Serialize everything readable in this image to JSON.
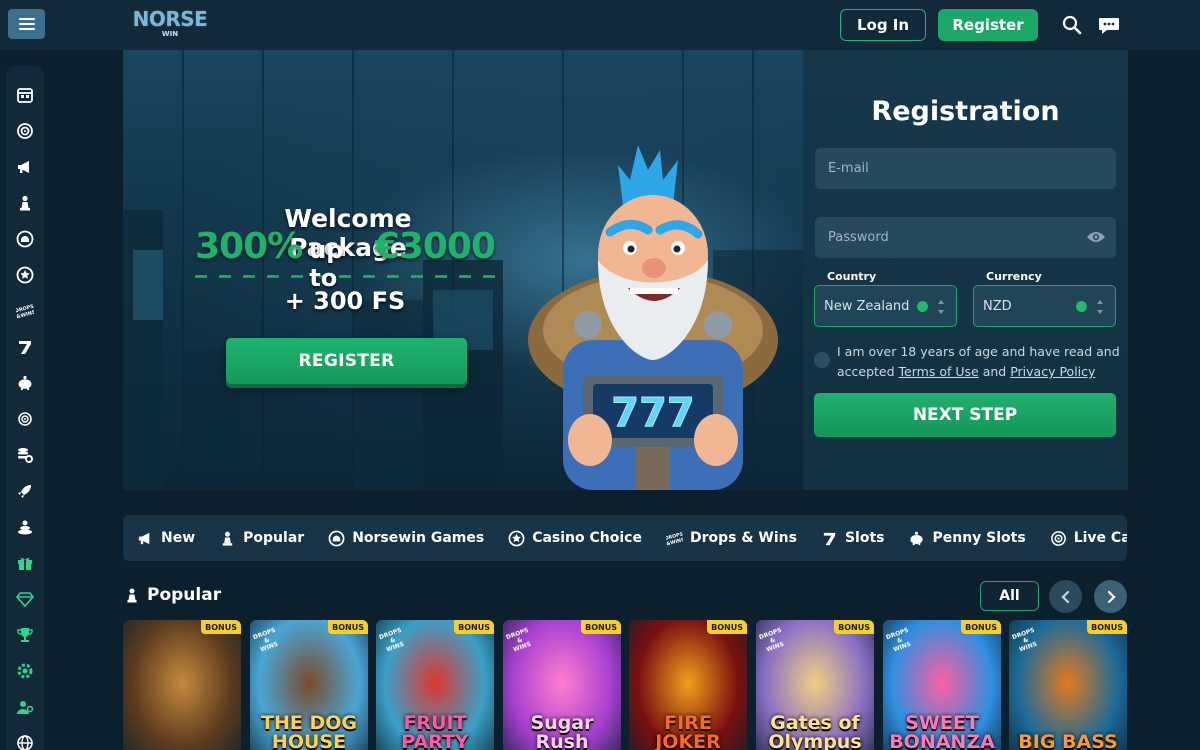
{
  "header": {
    "logo_text": "NORSE",
    "logo_subtext": "WIN",
    "login_label": "Log In",
    "register_label": "Register",
    "icons": [
      "menu-icon",
      "search-icon",
      "chat-icon"
    ]
  },
  "sidebar": {
    "icons": [
      "calendar-icon",
      "target-icon",
      "megaphone-icon",
      "chess-pawn-icon",
      "helmet-icon",
      "badge-icon",
      "drops-wins-icon",
      "seven-icon",
      "piggy-bank-icon",
      "live-icon",
      "coins-icon",
      "rocket-icon",
      "bonus-stack-icon",
      "gift-icon",
      "diamond-icon",
      "trophy-icon",
      "settings-icon",
      "users-icon",
      "globe-icon"
    ],
    "drops_text": "DROPS & WINS"
  },
  "hero": {
    "title": "Welcome Package",
    "offer_percent": "300%",
    "offer_mid": "up to",
    "offer_amount": "€3000",
    "offer_fs": "+ 300 FS",
    "register_label": "REGISTER",
    "sign_text": "777"
  },
  "registration": {
    "title": "Registration",
    "email_placeholder": "E-mail",
    "password_placeholder": "Password",
    "country_label": "Country",
    "country_value": "New Zealand",
    "currency_label": "Currency",
    "currency_value": "NZD",
    "terms_prefix": "I am over 18 years of age and have read and accepted",
    "terms_link": "Terms of Use",
    "terms_and": "and",
    "privacy_link": "Privacy Policy",
    "next_label": "NEXT STEP"
  },
  "categories": [
    {
      "label": "New",
      "icon": "megaphone-icon"
    },
    {
      "label": "Popular",
      "icon": "chess-pawn-icon"
    },
    {
      "label": "Norsewin Games",
      "icon": "helmet-icon"
    },
    {
      "label": "Casino Choice",
      "icon": "badge-icon"
    },
    {
      "label": "Drops & Wins",
      "icon": "drops-wins-icon"
    },
    {
      "label": "Slots",
      "icon": "seven-icon"
    },
    {
      "label": "Penny Slots",
      "icon": "piggy-bank-icon"
    },
    {
      "label": "Live Casino",
      "icon": "live-icon"
    },
    {
      "label": "",
      "icon": "coins-icon"
    }
  ],
  "popular": {
    "title": "Popular",
    "all_label": "All",
    "games": [
      {
        "name": "",
        "badge": "BONUS",
        "drops": false,
        "bg": "#5a3a1e",
        "accent": "#c48a3c",
        "text_color": "#f2c86b"
      },
      {
        "name": "THE DOG HOUSE",
        "badge": "BONUS",
        "drops": true,
        "bg": "#4aa6d6",
        "accent": "#7a4b2b",
        "text_color": "#ffd24a"
      },
      {
        "name": "FRUIT PARTY",
        "badge": "BONUS",
        "drops": true,
        "bg": "#3aa0c8",
        "accent": "#e0362f",
        "text_color": "#ff5aa8"
      },
      {
        "name": "Sugar Rush",
        "badge": "BONUS",
        "drops": true,
        "bg": "#a63fd1",
        "accent": "#ff7fd0",
        "text_color": "#ffd1f0"
      },
      {
        "name": "FIRE JOKER",
        "badge": "BONUS",
        "drops": false,
        "bg": "#7a1010",
        "accent": "#f1a11a",
        "text_color": "#ff6a1a"
      },
      {
        "name": "Gates of Olympus",
        "badge": "BONUS",
        "drops": true,
        "bg": "#8a6fc6",
        "accent": "#f0d080",
        "text_color": "#ffe28a"
      },
      {
        "name": "SWEET BONANZA",
        "badge": "BONUS",
        "drops": true,
        "bg": "#2f8fe0",
        "accent": "#ff5ea3",
        "text_color": "#ff79b8"
      },
      {
        "name": "BIG BASS",
        "badge": "BONUS",
        "drops": true,
        "bg": "#1d6a9a",
        "accent": "#e37a1d",
        "text_color": "#ff9a2a"
      }
    ],
    "bonanza_sub": "BONANZA"
  },
  "colors": {
    "accent_green": "#1fb36a",
    "background": "#0b1f2d",
    "panel": "#183446"
  }
}
